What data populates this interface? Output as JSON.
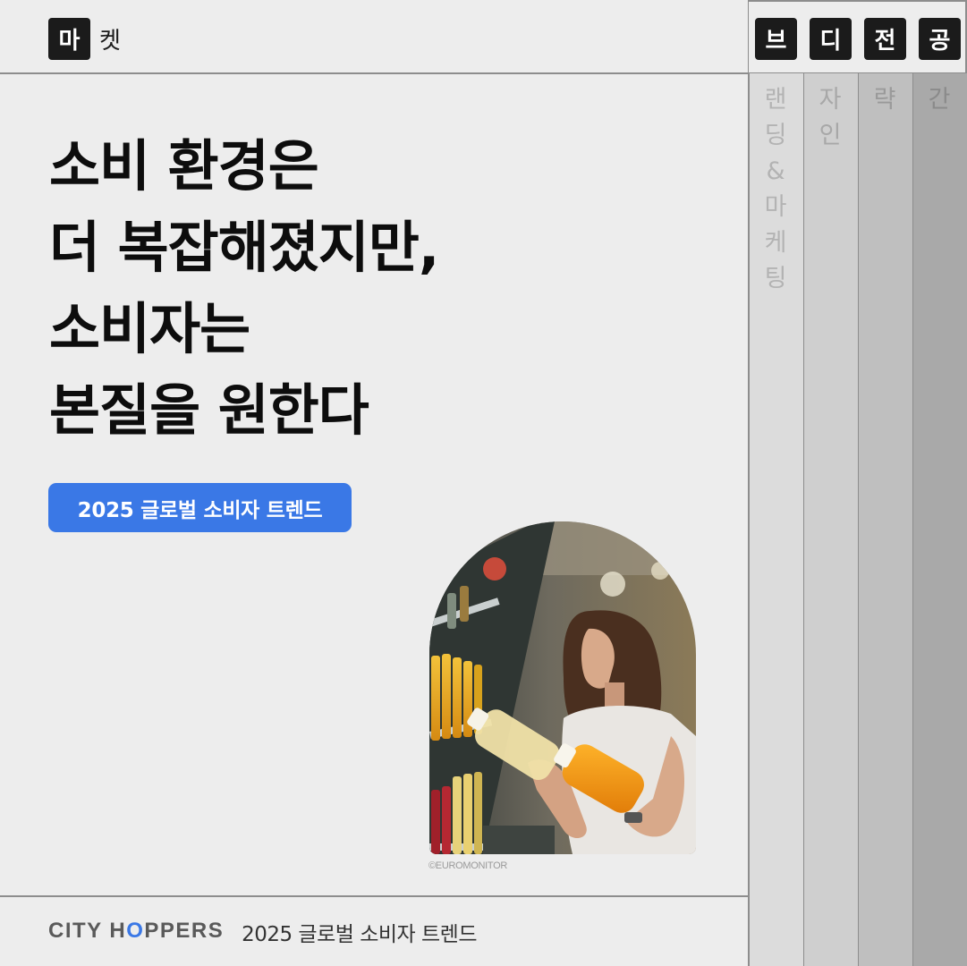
{
  "header": {
    "active_tab_chip": "마",
    "active_tab_rest": "켓"
  },
  "side_tabs": [
    {
      "chip": "브",
      "rest": [
        "랜",
        "딩",
        "&",
        "마",
        "케",
        "팅"
      ],
      "bg": "#dcdcdc",
      "text_color": "#b3b3b3"
    },
    {
      "chip": "디",
      "rest": [
        "자",
        "인"
      ],
      "bg": "#cfcfcf",
      "text_color": "#a8a8a8"
    },
    {
      "chip": "전",
      "rest": [
        "략"
      ],
      "bg": "#bfbfbf",
      "text_color": "#9a9a9a"
    },
    {
      "chip": "공",
      "rest": [
        "간"
      ],
      "bg": "#a9a9a9",
      "text_color": "#8b8b8b"
    }
  ],
  "headline": [
    "소비 환경은",
    "더 복잡해졌지만,",
    "소비자는",
    "본질을 원한다"
  ],
  "pill_label": "2025 글로벌 소비자 트렌드",
  "photo_credit": "©EUROMONITOR",
  "footer": {
    "logo_pre": "CITY H",
    "logo_mark": "O",
    "logo_post": "PPERS",
    "title": "2025 글로벌 소비자 트렌드"
  },
  "colors": {
    "accent": "#3a78e6",
    "chip": "#1b1b1b",
    "background": "#ededed"
  }
}
